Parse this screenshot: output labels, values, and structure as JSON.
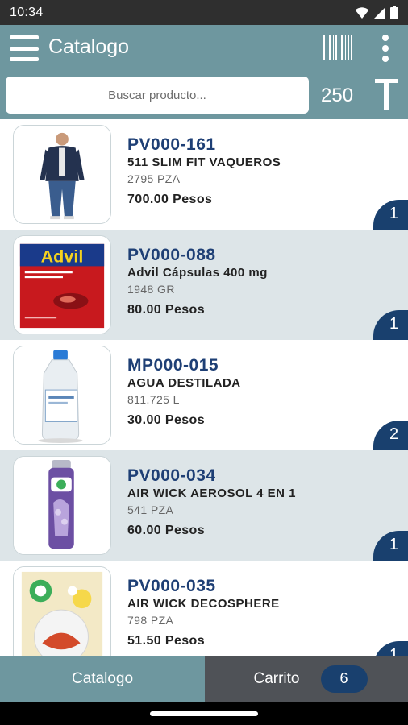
{
  "status_bar": {
    "time": "10:34",
    "icons": [
      "wifi-icon",
      "signal-icon",
      "battery-icon"
    ]
  },
  "app_bar": {
    "title": "Catalogo",
    "icons": [
      "menu-icon",
      "barcode-icon",
      "more-vert-icon"
    ]
  },
  "search": {
    "placeholder": "Buscar producto...",
    "value": "",
    "count": "250",
    "text_tool_icon": "text-format-icon"
  },
  "products": [
    {
      "code": "PV000-161",
      "name": "511 SLIM FIT VAQUEROS",
      "stock": "2795 PZA",
      "price": "700.00 Pesos",
      "qty": "1",
      "image_icon": "jacket-man-image"
    },
    {
      "code": "PV000-088",
      "name": "Advil Cápsulas 400 mg",
      "stock": "1948 GR",
      "price": "80.00 Pesos",
      "qty": "1",
      "image_icon": "advil-box-image",
      "image_logo_text": "Advil"
    },
    {
      "code": "MP000-015",
      "name": "AGUA DESTILADA",
      "stock": "811.725 L",
      "price": "30.00 Pesos",
      "qty": "2",
      "image_icon": "water-bottle-image"
    },
    {
      "code": "PV000-034",
      "name": "AIR WICK AEROSOL 4 EN 1",
      "stock": "541 PZA",
      "price": "60.00 Pesos",
      "qty": "1",
      "image_icon": "aerosol-can-image"
    },
    {
      "code": "PV000-035",
      "name": "AIR WICK DECOSPHERE",
      "stock": "798 PZA",
      "price": "51.50 Pesos",
      "qty": "1",
      "image_icon": "decosphere-box-image"
    }
  ],
  "bottom_tabs": {
    "catalogo": "Catalogo",
    "carrito": "Carrito",
    "cart_count": "6"
  },
  "colors": {
    "app_bar": "#6e979f",
    "status_bar": "#2f2f2f",
    "accent_navy": "#19406e",
    "code_text": "#1e3f75",
    "row_alt": "#dde5e8",
    "tab_inactive": "#4f5257"
  }
}
